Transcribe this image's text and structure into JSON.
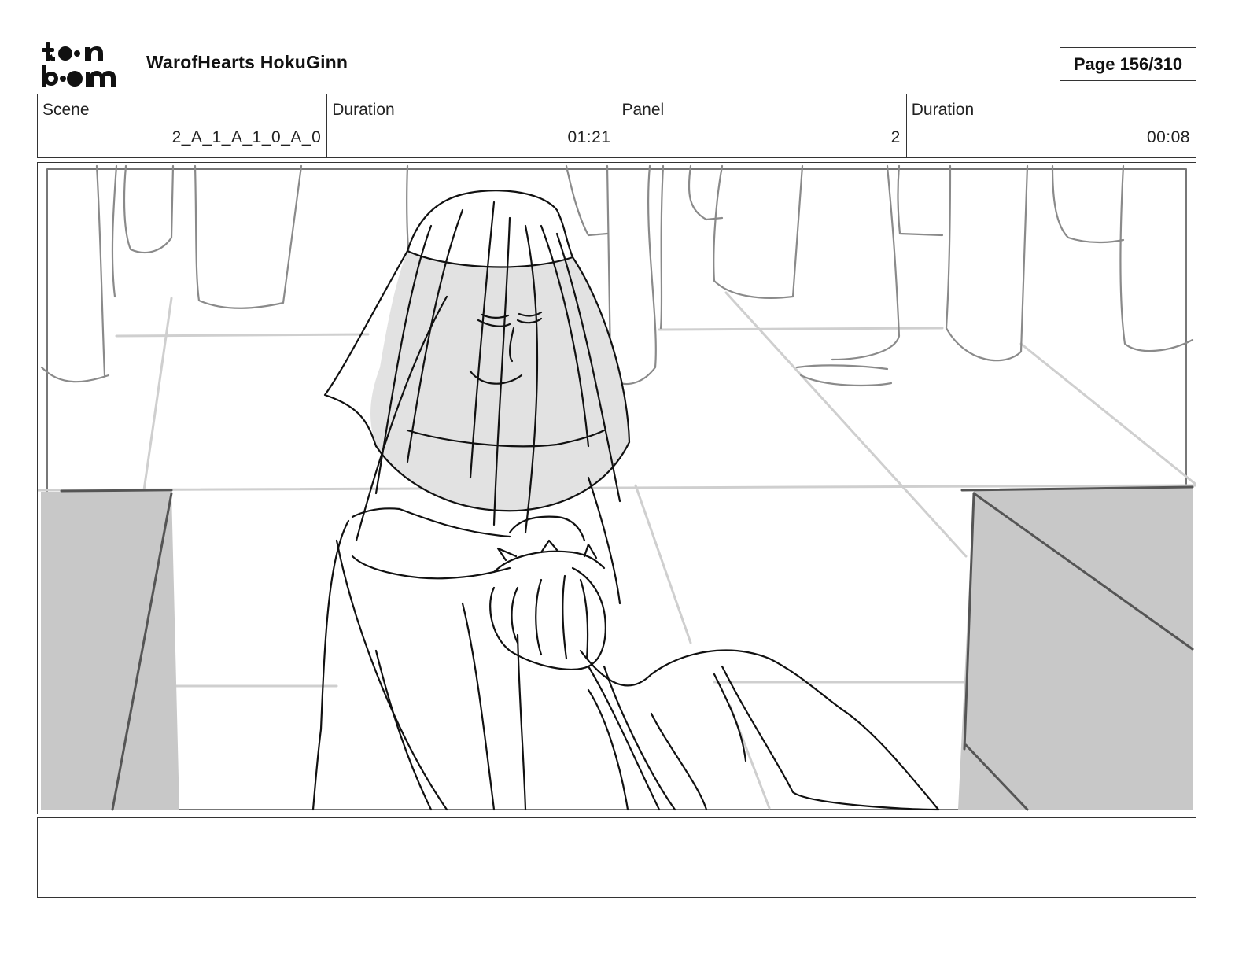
{
  "header": {
    "logo_text_line1": "toon",
    "logo_text_line2": "boom",
    "project_title": "WarofHearts HokuGinn",
    "page_label": "Page 156/310"
  },
  "info": [
    {
      "label": "Scene",
      "value": "2_A_1_A_1_0_A_0"
    },
    {
      "label": "Duration",
      "value": "01:21"
    },
    {
      "label": "Panel",
      "value": "2"
    },
    {
      "label": "Duration",
      "value": "00:08"
    }
  ],
  "notes": {
    "text": ""
  },
  "colors": {
    "border": "#333333",
    "shade": "#c8c8c8",
    "light_shade": "#e6e6e6",
    "line": "#111111",
    "bg_line": "#9a9a9a"
  }
}
